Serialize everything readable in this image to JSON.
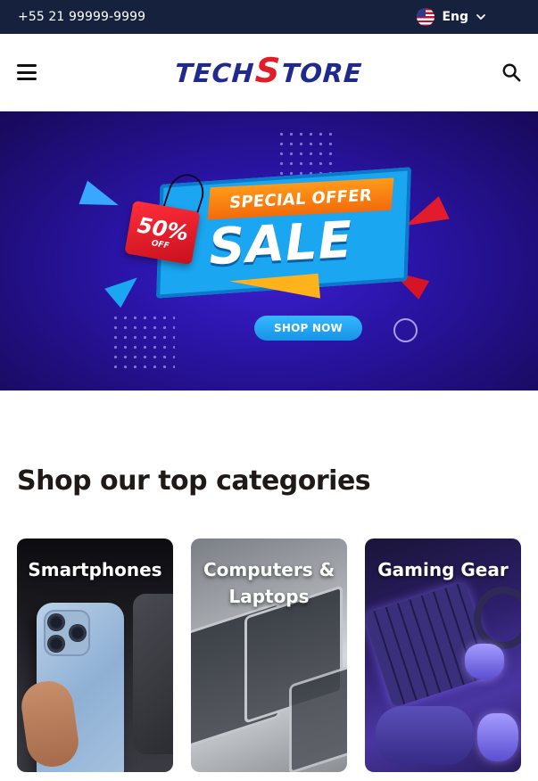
{
  "topbar": {
    "phone": "+55 21 99999-9999",
    "language_label": "Eng",
    "flag_icon": "us-flag-icon",
    "dropdown_icon": "chevron-down-icon"
  },
  "header": {
    "logo_left": "TECH",
    "logo_s": "S",
    "logo_right": "TORE",
    "menu_icon": "hamburger-icon",
    "search_icon": "search-icon"
  },
  "hero": {
    "offer_tag_percent": "50%",
    "offer_tag_suffix": "OFF",
    "special_offer": "SPECIAL OFFER",
    "sale": "SALE",
    "cta": "SHOP NOW"
  },
  "categories": {
    "title": "Shop our top categories",
    "items": [
      {
        "label": "Smartphones"
      },
      {
        "label": "Computers & Laptops"
      },
      {
        "label": "Gaming Gear"
      }
    ]
  },
  "colors": {
    "topbar_bg": "#16213e",
    "logo_blue": "#1f2a8c",
    "logo_red": "#e11d2a",
    "hero_bg": "#2a14a6",
    "cta_blue": "#1693e6",
    "offer_orange": "#f36b0b"
  }
}
